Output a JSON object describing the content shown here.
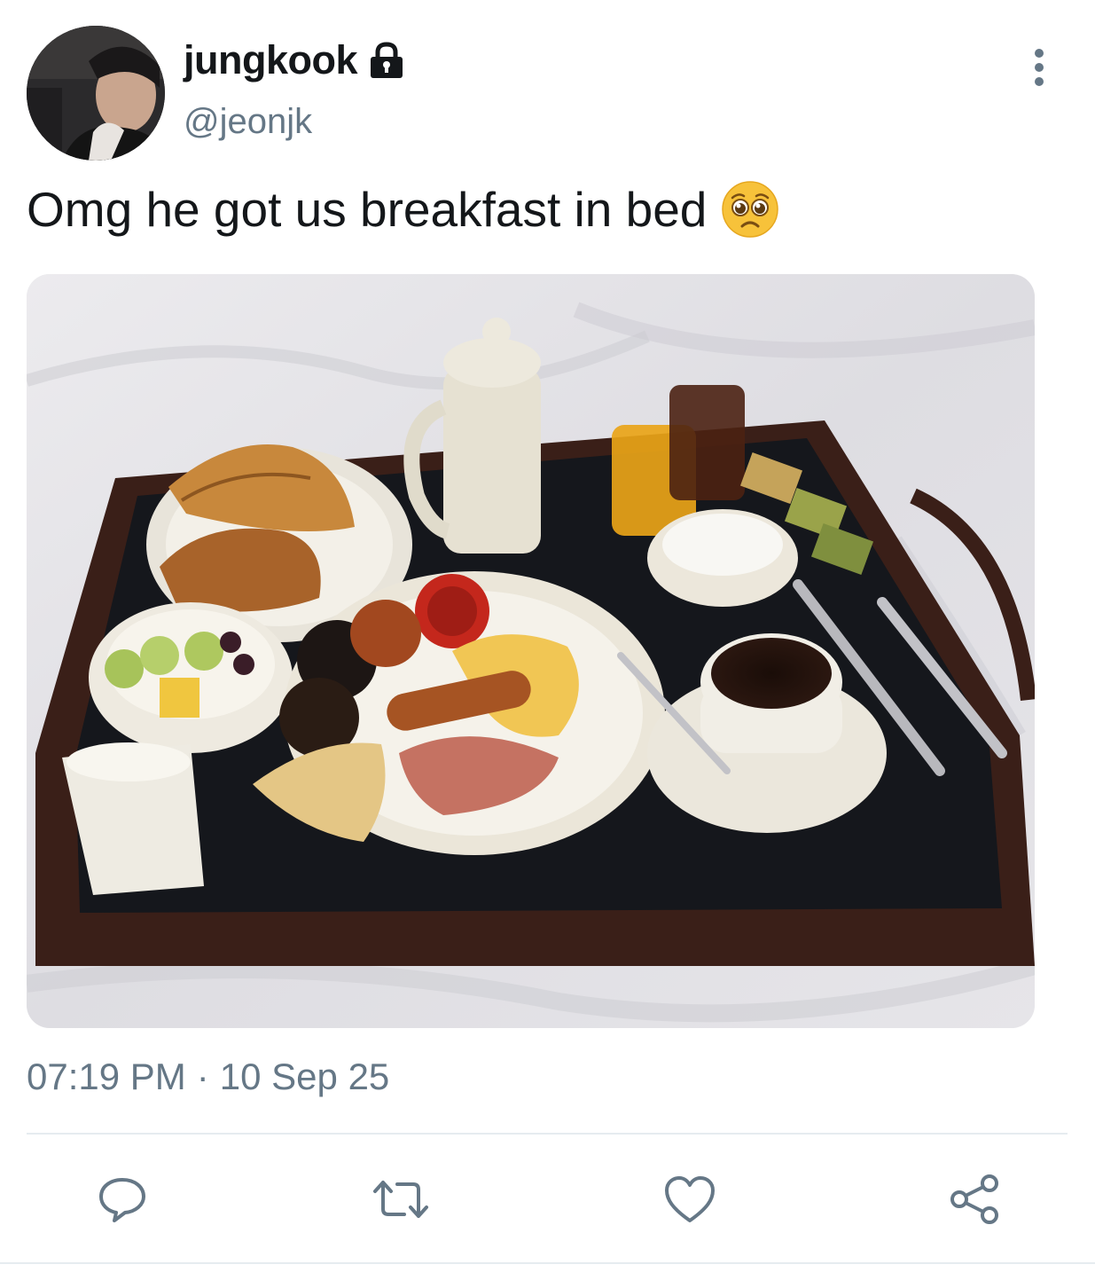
{
  "author": {
    "display_name": "jungkook",
    "handle": "@jeonjk",
    "avatar_icon": "avatar-photo",
    "protected_icon": "lock-icon"
  },
  "tweet": {
    "text": "Omg he got us breakfast in bed",
    "emoji_icon": "pleading-face-emoji",
    "time": "07:19 PM",
    "separator": "·",
    "date": "10 Sep 25"
  },
  "media": {
    "icon": "breakfast-tray-photo"
  },
  "actions": [
    {
      "name": "reply",
      "icon": "reply-icon"
    },
    {
      "name": "retweet",
      "icon": "retweet-icon"
    },
    {
      "name": "like",
      "icon": "heart-icon"
    },
    {
      "name": "share",
      "icon": "share-icon"
    }
  ],
  "colors": {
    "text_primary": "#14171a",
    "text_secondary": "#657786",
    "icon_gray": "#657786",
    "divider": "#e6ecf0"
  }
}
